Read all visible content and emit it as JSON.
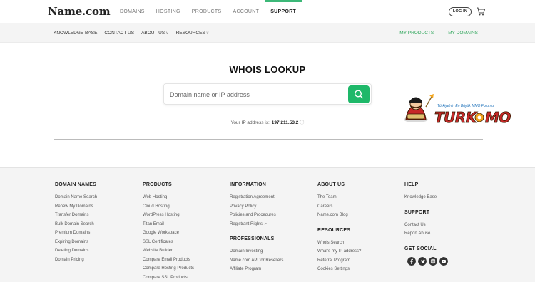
{
  "header": {
    "logo": "Name.com",
    "nav": [
      "DOMAINS",
      "HOSTING",
      "PRODUCTS",
      "ACCOUNT",
      "SUPPORT"
    ],
    "active_nav": "SUPPORT",
    "login_label": "LOG IN",
    "accent_color": "#3cb878"
  },
  "subnav": {
    "left": [
      {
        "label": "KNOWLEDGE BASE",
        "chevron": ""
      },
      {
        "label": "CONTACT US",
        "chevron": ""
      },
      {
        "label": "ABOUT US",
        "chevron": "∨"
      },
      {
        "label": "RESOURCES",
        "chevron": "∨"
      }
    ],
    "right": [
      "MY PRODUCTS",
      "MY DOMAINS"
    ]
  },
  "main": {
    "title": "WHOIS LOOKUP",
    "search_placeholder": "Domain name or IP address",
    "search_value": "",
    "ip_label": "Your IP address is:",
    "ip_value": "197.211.53.2",
    "button_color": "#1eb869"
  },
  "forum_logo": {
    "text": "TURKMMO",
    "tagline": "Türkiye'nin En Büyük MMO Forumu"
  },
  "footer": {
    "columns": [
      {
        "sections": [
          {
            "heading": "DOMAIN NAMES",
            "links": [
              "Domain Name Search",
              "Renew My Domains",
              "Transfer Domains",
              "Bulk Domain Search",
              "Premium Domains",
              "Expiring Domains",
              "Deleting Domains",
              "Domain Pricing"
            ]
          }
        ]
      },
      {
        "sections": [
          {
            "heading": "PRODUCTS",
            "links": [
              "Web Hosting",
              "Cloud Hosting",
              "WordPress Hosting",
              "Titan Email",
              "Google Workspace",
              "SSL Certificates",
              "Website Builder",
              "Compare Email Products",
              "Compare Hosting Products",
              "Compare SSL Products"
            ]
          }
        ]
      },
      {
        "sections": [
          {
            "heading": "INFORMATION",
            "links": [
              "Registration Agreement",
              "Privacy Policy",
              "Policies and Procedures",
              "Registrant Rights"
            ]
          },
          {
            "heading": "PROFESSIONALS",
            "links": [
              "Domain Investing",
              "Name.com API for Resellers",
              "Affiliate Program"
            ]
          }
        ]
      },
      {
        "sections": [
          {
            "heading": "ABOUT US",
            "links": [
              "The Team",
              "Careers",
              "Name.com Blog"
            ]
          },
          {
            "heading": "RESOURCES",
            "links": [
              "Whois Search",
              "What's my IP address?",
              "Referral Program",
              "Cookies Settings"
            ]
          }
        ]
      },
      {
        "sections": [
          {
            "heading": "HELP",
            "links": [
              "Knowledge Base"
            ]
          },
          {
            "heading": "SUPPORT",
            "links": [
              "Contact Us",
              "Report Abuse"
            ]
          },
          {
            "heading": "GET SOCIAL",
            "links": []
          }
        ]
      }
    ],
    "social_icons": [
      "facebook-icon",
      "twitter-icon",
      "instagram-icon",
      "youtube-icon"
    ]
  }
}
